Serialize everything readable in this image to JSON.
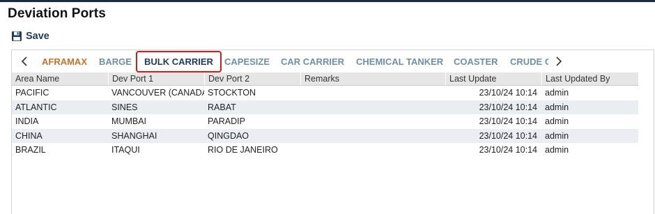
{
  "page": {
    "title": "Deviation Ports"
  },
  "toolbar": {
    "save_label": "Save",
    "save_icon": "floppy-disk-icon"
  },
  "tabs": {
    "items": [
      {
        "label": "AFRAMAX",
        "state": "warning"
      },
      {
        "label": "BARGE",
        "state": "normal"
      },
      {
        "label": "BULK CARRIER",
        "state": "selected"
      },
      {
        "label": "CAPESIZE",
        "state": "normal"
      },
      {
        "label": "CAR CARRIER",
        "state": "normal"
      },
      {
        "label": "CHEMICAL TANKER",
        "state": "normal"
      },
      {
        "label": "COASTER",
        "state": "normal"
      },
      {
        "label": "CRUDE C",
        "state": "normal"
      }
    ],
    "prev_icon": "chevron-left-icon",
    "next_icon": "chevron-right-icon"
  },
  "grid": {
    "columns": [
      "Area Name",
      "Dev Port 1",
      "Dev Port 2",
      "Remarks",
      "Last Update",
      "Last Updated By"
    ],
    "rows": [
      [
        "PACIFIC",
        "VANCOUVER (CANADA)",
        "STOCKTON",
        "",
        "23/10/24 10:14",
        "admin"
      ],
      [
        "ATLANTIC",
        "SINES",
        "RABAT",
        "",
        "23/10/24 10:14",
        "admin"
      ],
      [
        "INDIA",
        "MUMBAI",
        "PARADIP",
        "",
        "23/10/24 10:14",
        "admin"
      ],
      [
        "CHINA",
        "SHANGHAI",
        "QINGDAO",
        "",
        "23/10/24 10:14",
        "admin"
      ],
      [
        "BRAZIL",
        "ITAQUI",
        "RIO DE JANEIRO",
        "",
        "23/10/24 10:14",
        "admin"
      ]
    ]
  },
  "colors": {
    "warning_tab": "#c9702b",
    "tab": "#6e8fa6",
    "selected_tab": "#1e3b5a",
    "selected_outline": "#d01c1c",
    "row_alt": "#eaeef2"
  }
}
